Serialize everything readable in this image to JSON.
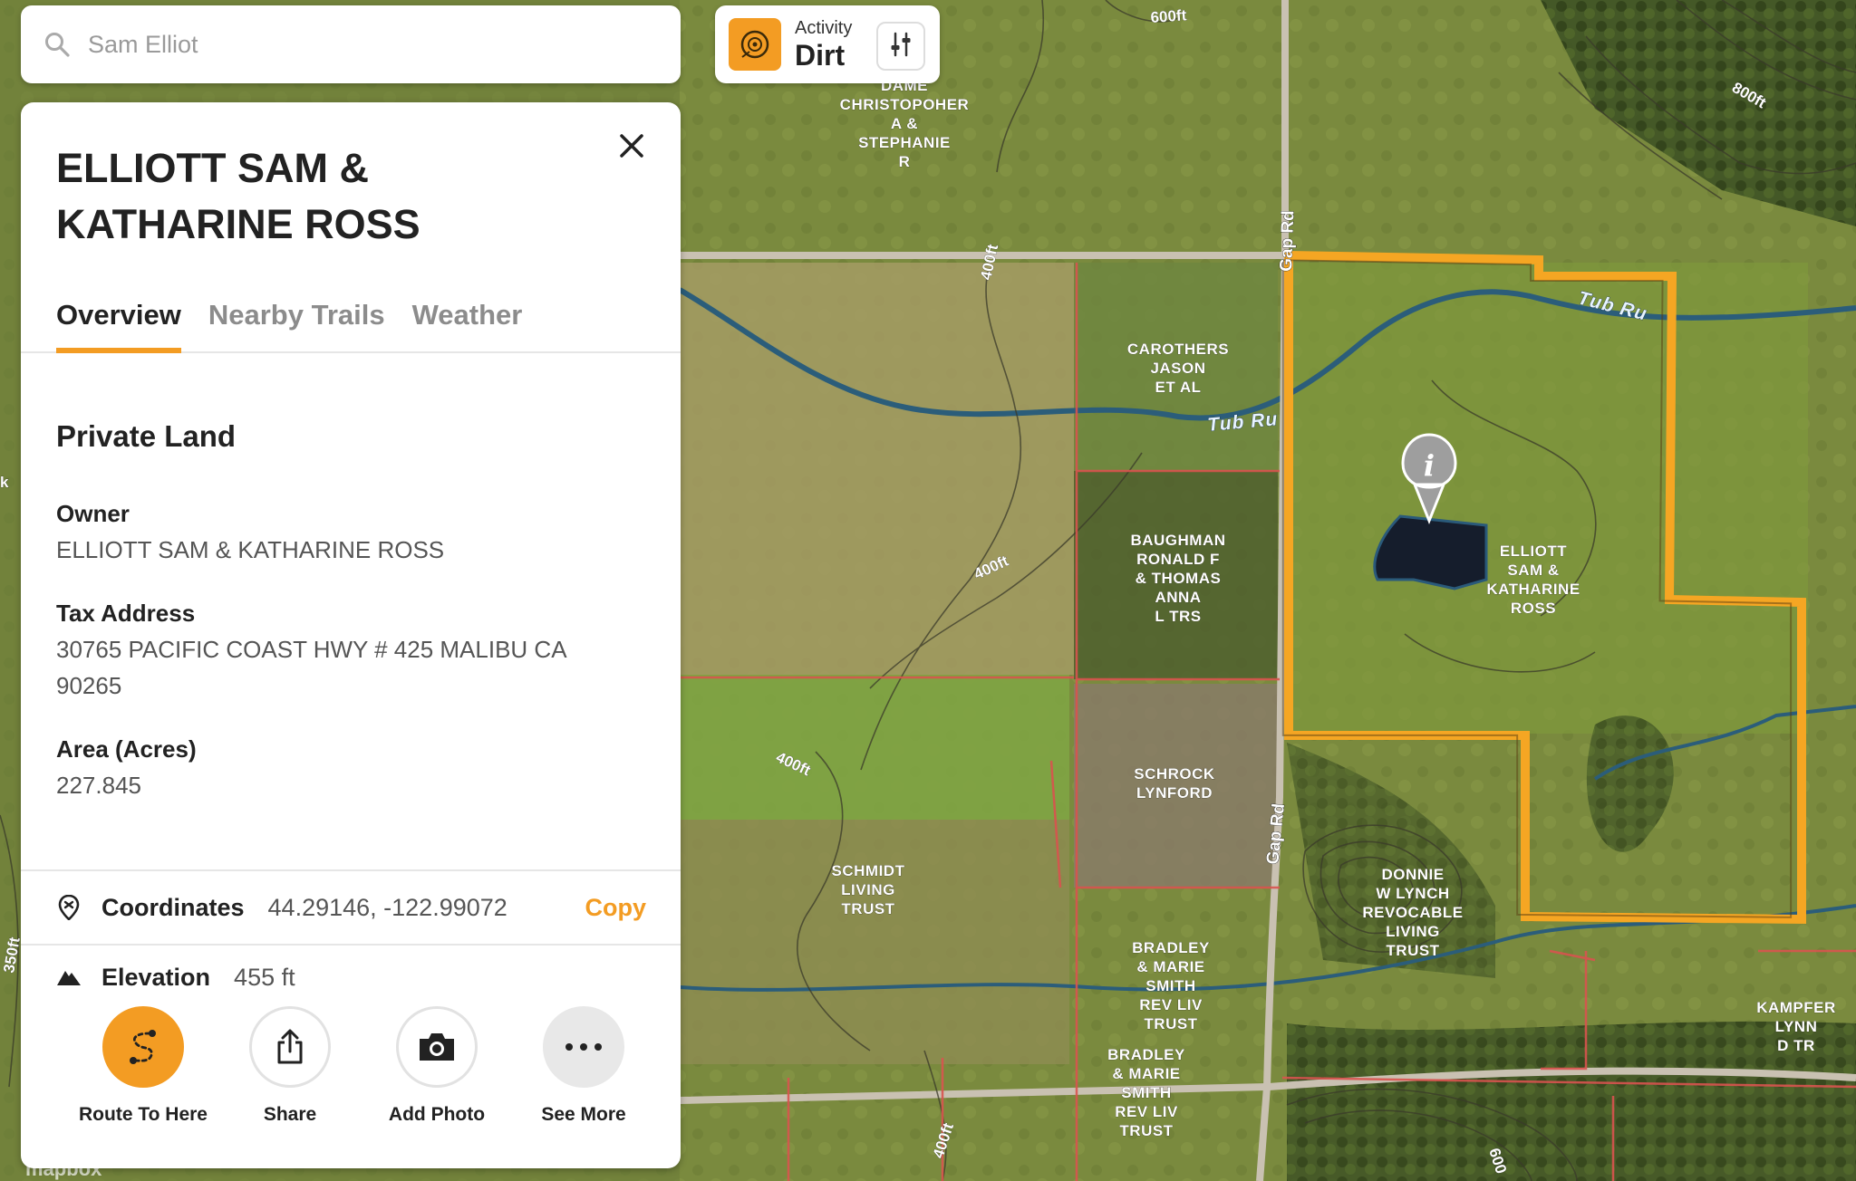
{
  "search": {
    "placeholder": "Sam Elliot"
  },
  "activity": {
    "label": "Activity",
    "value": "Dirt"
  },
  "panel": {
    "title": "ELLIOTT SAM & KATHARINE ROSS",
    "tabs": [
      {
        "label": "Overview",
        "active": true
      },
      {
        "label": "Nearby Trails",
        "active": false
      },
      {
        "label": "Weather",
        "active": false
      }
    ],
    "section_heading": "Private Land",
    "fields": {
      "owner_label": "Owner",
      "owner_value": "ELLIOTT SAM & KATHARINE ROSS",
      "tax_label": "Tax Address",
      "tax_value": "30765 PACIFIC COAST HWY # 425 MALIBU CA 90265",
      "area_label": "Area (Acres)",
      "area_value": "227.845"
    },
    "coordinates": {
      "label": "Coordinates",
      "value": "44.29146, -122.99072",
      "copy_label": "Copy"
    },
    "elevation": {
      "label": "Elevation",
      "value": "455 ft"
    },
    "actions": [
      {
        "label": "Route To Here",
        "icon": "route-icon"
      },
      {
        "label": "Share",
        "icon": "share-icon"
      },
      {
        "label": "Add Photo",
        "icon": "camera-icon"
      },
      {
        "label": "See More",
        "icon": "more-icon"
      }
    ]
  },
  "map": {
    "labels": {
      "dame": "DAME",
      "christopoher": "CHRISTOPOHER",
      "a_and": "A &",
      "stephanie": "STEPHANIE",
      "r": "R",
      "carothers": "CAROTHERS",
      "jason": "JASON",
      "et_al": "ET AL",
      "baughman": "BAUGHMAN",
      "ronald_f": "RONALD F",
      "and_thomas": "& THOMAS",
      "anna": "ANNA",
      "l_trs": "L TRS",
      "elliott": "ELLIOTT",
      "sam_and": "SAM &",
      "katharine": "KATHARINE",
      "ross": "ROSS",
      "schrock": "SCHROCK",
      "lynford": "LYNFORD",
      "schmidt": "SCHMIDT",
      "living": "LIVING",
      "trust": "TRUST",
      "donnie": "DONNIE",
      "w_lynch": "W LYNCH",
      "revocable": "REVOCABLE",
      "living2": "LIVING",
      "trust2": "TRUST",
      "bradley": "BRADLEY",
      "and_marie": "& MARIE",
      "smith": "SMITH",
      "rev_liv": "REV LIV",
      "trust3": "TRUST",
      "bradley2": "BRADLEY",
      "and_marie2": "& MARIE",
      "smith2": "SMITH",
      "rev_liv2": "REV LIV",
      "trust4": "TRUST",
      "kampfer": "KAMPFER",
      "lynn": "LYNN",
      "d_tr": "D TR",
      "tub_run_1": "Tub Ru",
      "tub_run_2": "Tub Ru",
      "gap_rd_1": "Gap Rd",
      "gap_rd_2": "Gap Rd",
      "c600ft": "600ft",
      "c800ft": "800ft",
      "c400ft_1": "400ft",
      "c400ft_2": "400ft",
      "c400ft_3": "400ft",
      "c400ft_4": "400ft",
      "c350ft": "350ft",
      "c600_b": "600",
      "k": "k",
      "mapbox": "mapbox"
    },
    "colors": {
      "boundary": "#f5a623",
      "parcel": "#d9534f",
      "water": "#1f4a6b",
      "accent": "#f39c23"
    }
  }
}
